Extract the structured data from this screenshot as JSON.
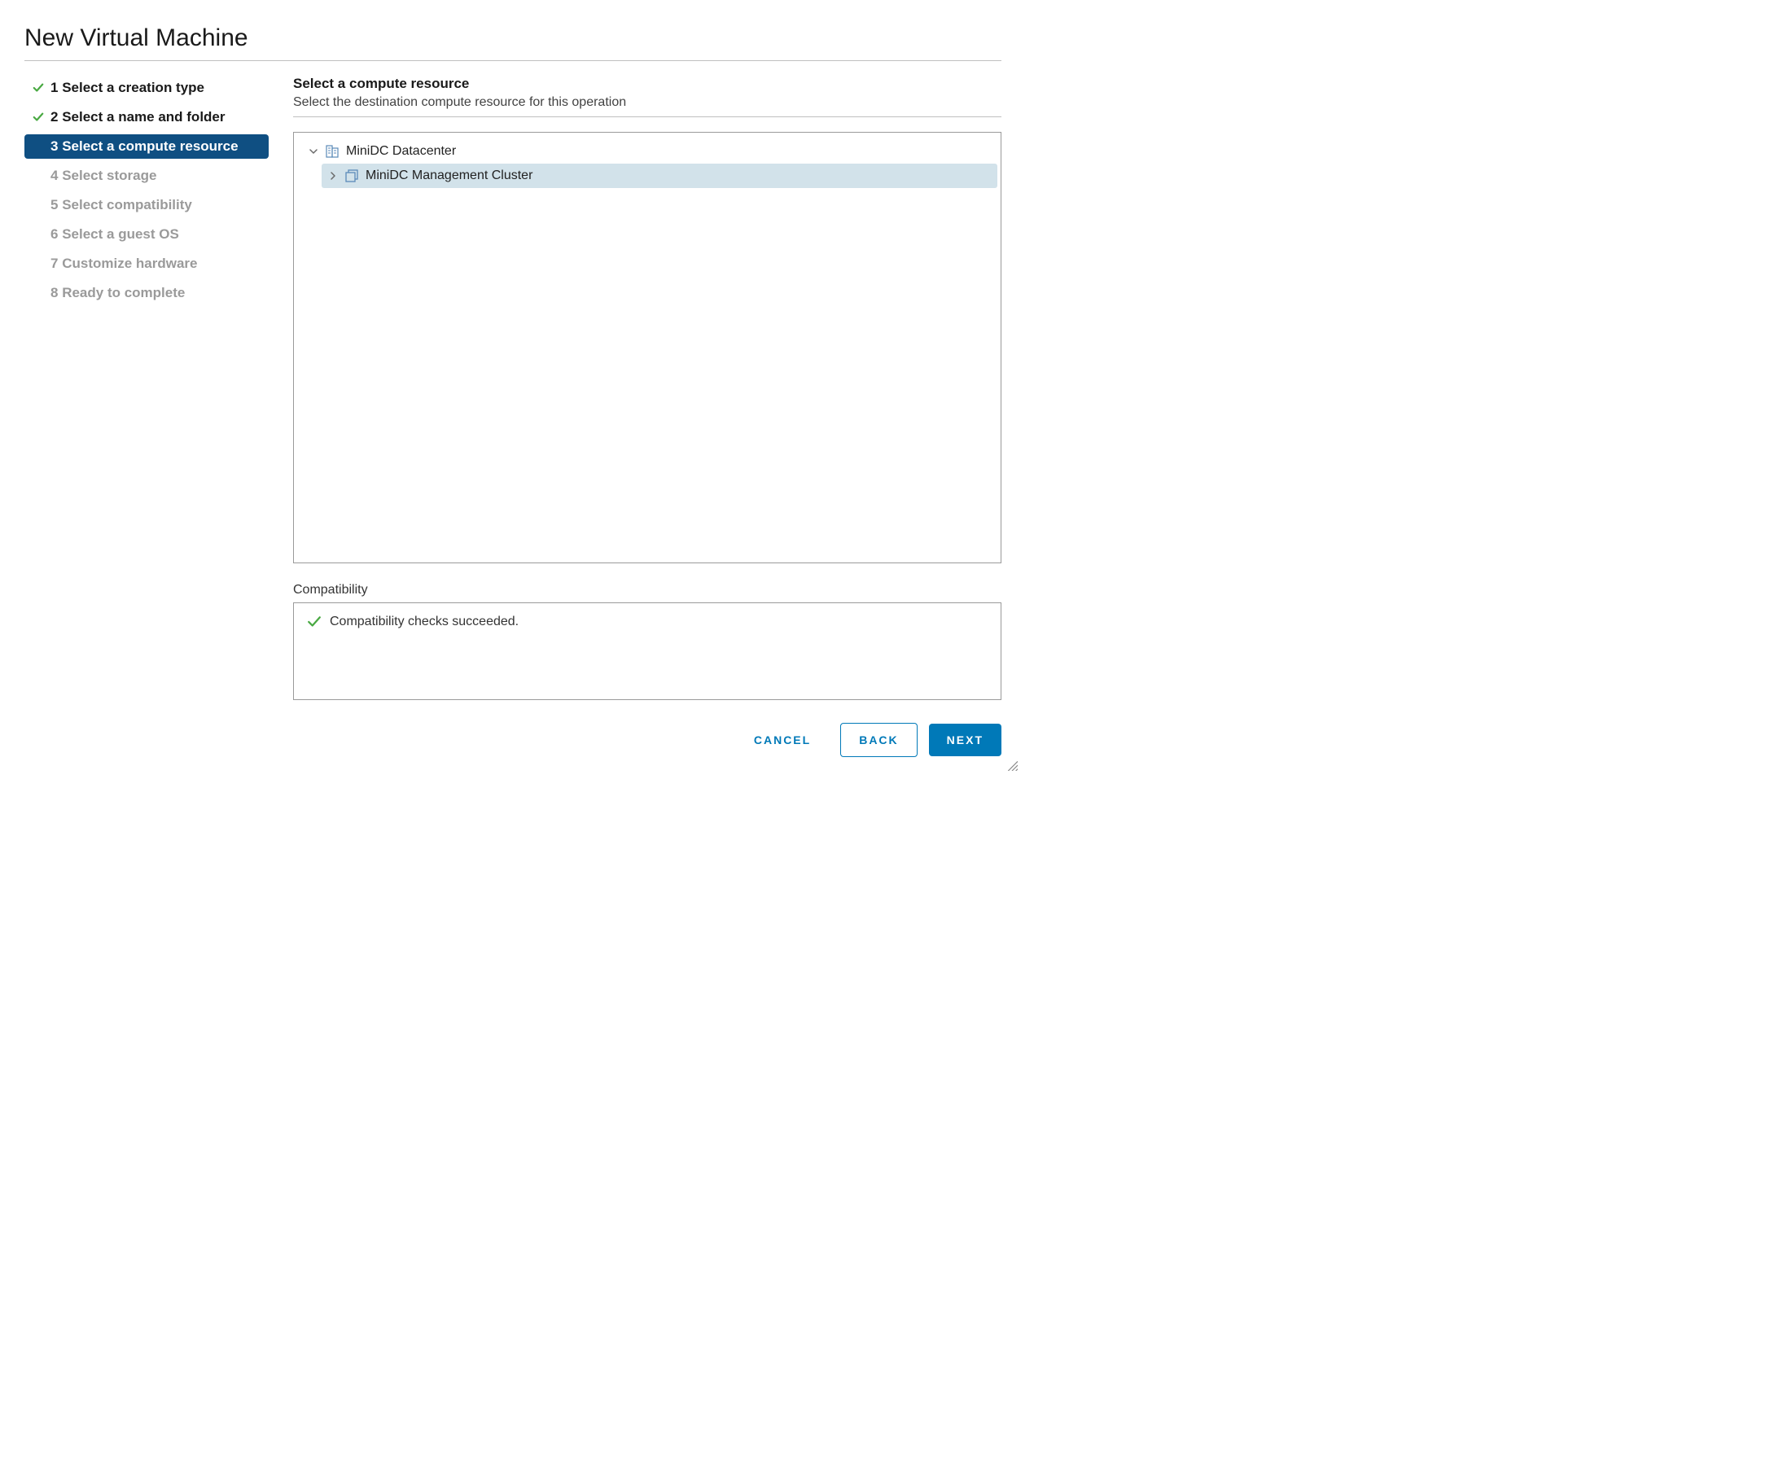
{
  "dialog": {
    "title": "New Virtual Machine"
  },
  "wizard": {
    "steps": [
      {
        "num": "1",
        "label": "Select a creation type",
        "state": "completed"
      },
      {
        "num": "2",
        "label": "Select a name and folder",
        "state": "completed"
      },
      {
        "num": "3",
        "label": "Select a compute resource",
        "state": "current"
      },
      {
        "num": "4",
        "label": "Select storage",
        "state": "pending"
      },
      {
        "num": "5",
        "label": "Select compatibility",
        "state": "pending"
      },
      {
        "num": "6",
        "label": "Select a guest OS",
        "state": "pending"
      },
      {
        "num": "7",
        "label": "Customize hardware",
        "state": "pending"
      },
      {
        "num": "8",
        "label": "Ready to complete",
        "state": "pending"
      }
    ]
  },
  "panel": {
    "heading": "Select a compute resource",
    "subheading": "Select the destination compute resource for this operation"
  },
  "tree": {
    "items": [
      {
        "label": "MiniDC Datacenter",
        "icon": "datacenter",
        "level": 0,
        "expanded": true,
        "selected": false
      },
      {
        "label": "MiniDC Management Cluster",
        "icon": "cluster",
        "level": 1,
        "expanded": false,
        "selected": true
      }
    ]
  },
  "compat": {
    "label": "Compatibility",
    "message": "Compatibility checks succeeded."
  },
  "buttons": {
    "cancel": "CANCEL",
    "back": "BACK",
    "next": "NEXT"
  }
}
